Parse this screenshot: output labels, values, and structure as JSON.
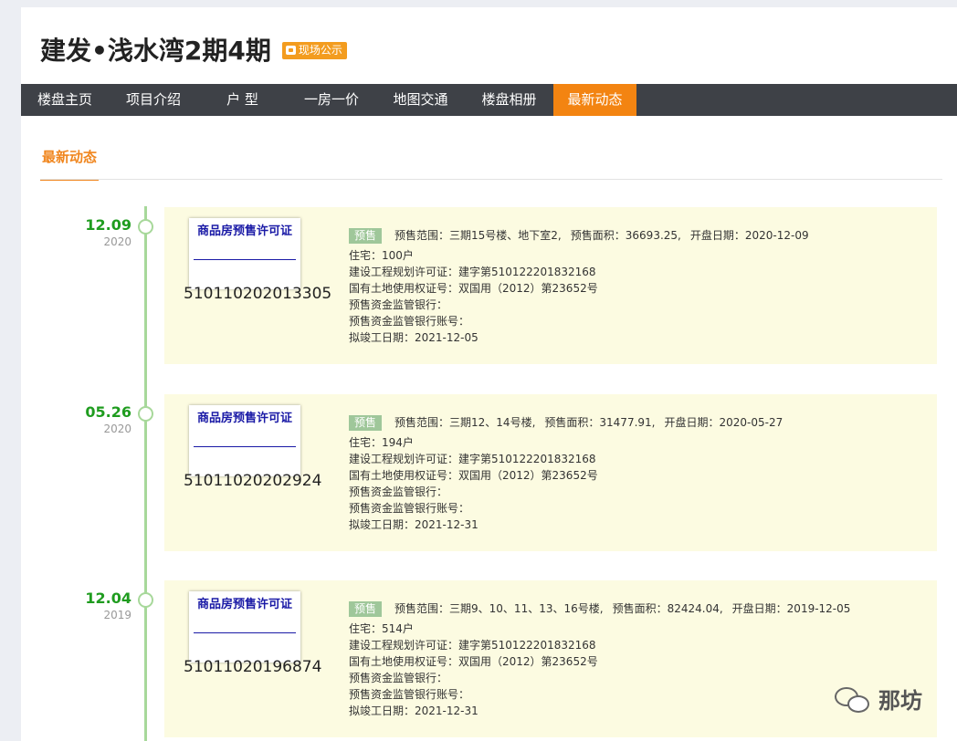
{
  "header": {
    "title": "建发•浅水湾2期4期",
    "badge": "现场公示"
  },
  "nav": {
    "items": [
      {
        "label": "楼盘主页"
      },
      {
        "label": "项目介绍"
      },
      {
        "label": "户 型"
      },
      {
        "label": "一房一价"
      },
      {
        "label": "地图交通"
      },
      {
        "label": "楼盘相册"
      },
      {
        "label": "最新动态",
        "active": true
      }
    ]
  },
  "section": {
    "tab_label": "最新动态"
  },
  "entries": [
    {
      "date": "12.09",
      "year": "2020",
      "cert_title": "商品房预售许可证",
      "cert_number": "510110202013305",
      "tag": "预售",
      "range_label": "预售范围：",
      "range_value": "三期15号楼、地下室2,",
      "area_label": "预售面积：",
      "area_value": "36693.25,",
      "open_label": "开盘日期：",
      "open_value": "2020-12-09",
      "residence": "住宅：100户",
      "planning_permit": "建设工程规划许可证：建字第510122201832168",
      "land_cert": "国有土地使用权证号：双国用（2012）第23652号",
      "bank": "预售资金监管银行：",
      "bank_account": "预售资金监管银行账号：",
      "completion": "拟竣工日期：2021-12-05"
    },
    {
      "date": "05.26",
      "year": "2020",
      "cert_title": "商品房预售许可证",
      "cert_number": "51011020202924",
      "tag": "预售",
      "range_label": "预售范围：",
      "range_value": "三期12、14号楼,",
      "area_label": "预售面积：",
      "area_value": "31477.91,",
      "open_label": "开盘日期：",
      "open_value": "2020-05-27",
      "residence": "住宅：194户",
      "planning_permit": "建设工程规划许可证：建字第510122201832168",
      "land_cert": "国有土地使用权证号：双国用（2012）第23652号",
      "bank": "预售资金监管银行：",
      "bank_account": "预售资金监管银行账号：",
      "completion": "拟竣工日期：2021-12-31"
    },
    {
      "date": "12.04",
      "year": "2019",
      "cert_title": "商品房预售许可证",
      "cert_number": "51011020196874",
      "tag": "预售",
      "range_label": "预售范围：",
      "range_value": "三期9、10、11、13、16号楼,",
      "area_label": "预售面积：",
      "area_value": "82424.04,",
      "open_label": "开盘日期：",
      "open_value": "2019-12-05",
      "residence": "住宅：514户",
      "planning_permit": "建设工程规划许可证：建字第510122201832168",
      "land_cert": "国有土地使用权证号：双国用（2012）第23652号",
      "bank": "预售资金监管银行：",
      "bank_account": "预售资金监管银行账号：",
      "completion": "拟竣工日期：2021-12-31"
    }
  ],
  "watermark": {
    "text": "那坊",
    "icon": "wechat-icon"
  }
}
